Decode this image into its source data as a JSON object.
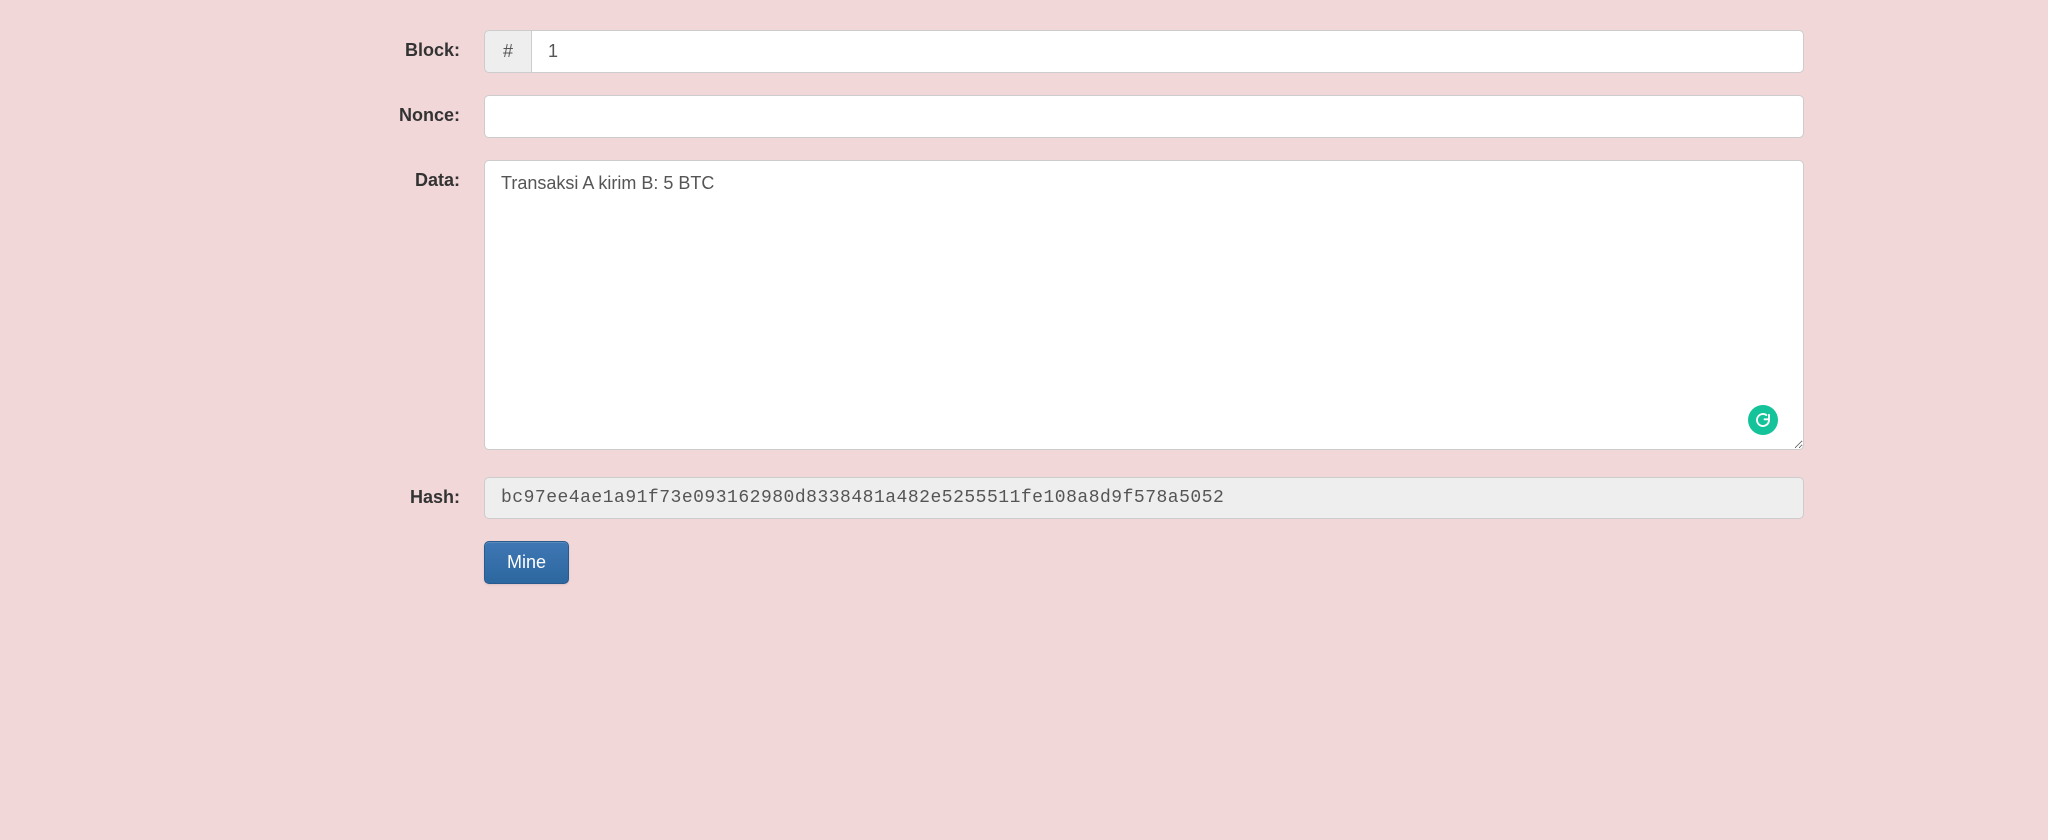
{
  "labels": {
    "block": "Block:",
    "nonce": "Nonce:",
    "data": "Data:",
    "hash": "Hash:"
  },
  "block": {
    "prefix": "#",
    "value": "1"
  },
  "nonce": {
    "value": ""
  },
  "data": {
    "value": "Transaksi A kirim B: 5 BTC"
  },
  "hash": {
    "value": "bc97ee4ae1a91f73e093162980d8338481a482e5255511fe108a8d9f578a5052"
  },
  "button": {
    "mine": "Mine"
  }
}
